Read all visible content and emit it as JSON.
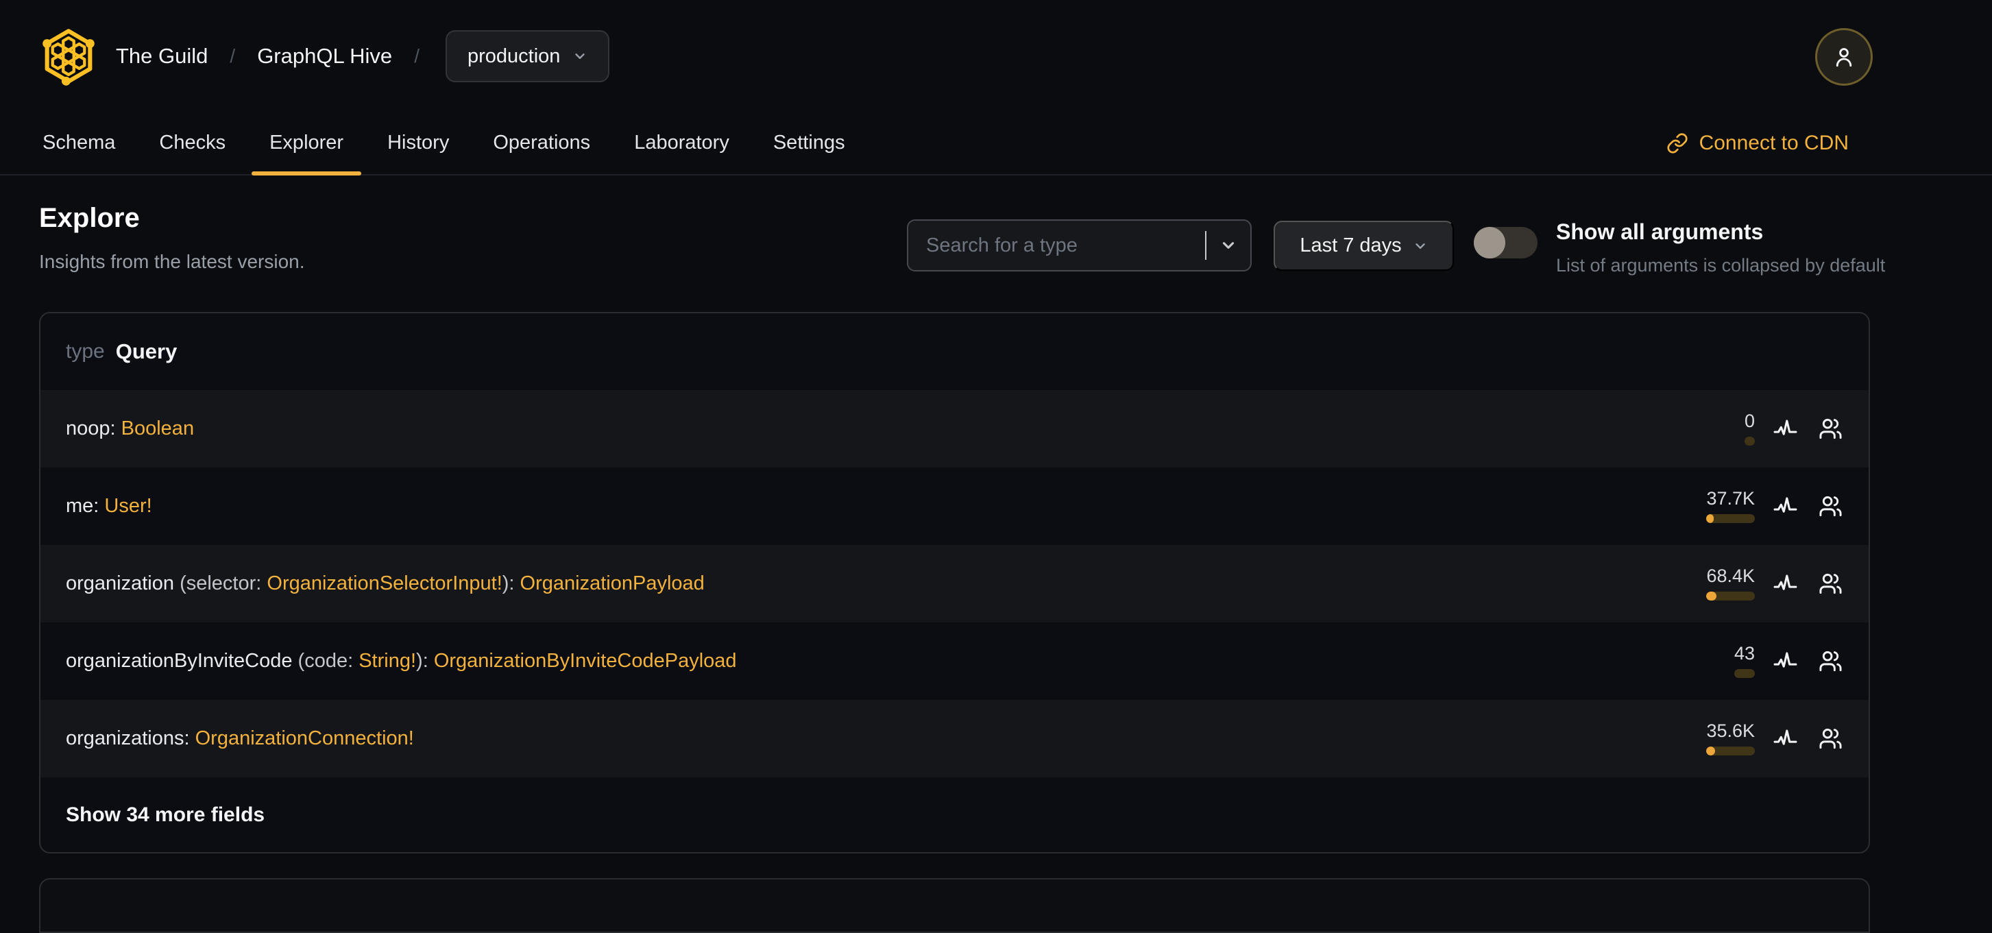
{
  "brand": {
    "org": "The Guild",
    "separator": "/",
    "project": "GraphQL Hive",
    "target": "production"
  },
  "tabs": {
    "items": [
      "Schema",
      "Checks",
      "Explorer",
      "History",
      "Operations",
      "Laboratory",
      "Settings"
    ],
    "active": "Explorer"
  },
  "cdn": {
    "label": "Connect to CDN"
  },
  "page": {
    "title": "Explore",
    "subtitle": "Insights from the latest version."
  },
  "controls": {
    "search": {
      "placeholder": "Search for a type"
    },
    "period": {
      "label": "Last 7 days"
    },
    "arguments_toggle": {
      "label": "Show all arguments",
      "hint": "List of arguments is collapsed by default",
      "state": "off"
    }
  },
  "card": {
    "kind": "type",
    "name": "Query",
    "rows": [
      {
        "segments": [
          {
            "text": "noop: ",
            "style": "field"
          },
          {
            "text": "Boolean",
            "style": "type"
          }
        ],
        "value": "0",
        "bar_percent": 0
      },
      {
        "segments": [
          {
            "text": "me: ",
            "style": "field"
          },
          {
            "text": "User!",
            "style": "type"
          }
        ],
        "value": "37.7K",
        "bar_percent": 15
      },
      {
        "segments": [
          {
            "text": "organization ",
            "style": "field"
          },
          {
            "text": "(selector: ",
            "style": "punct"
          },
          {
            "text": "OrganizationSelectorInput!",
            "style": "type"
          },
          {
            "text": "): ",
            "style": "punct"
          },
          {
            "text": "OrganizationPayload",
            "style": "type"
          }
        ],
        "value": "68.4K",
        "bar_percent": 21
      },
      {
        "segments": [
          {
            "text": "organizationByInviteCode ",
            "style": "field"
          },
          {
            "text": "(code: ",
            "style": "punct"
          },
          {
            "text": "String!",
            "style": "type"
          },
          {
            "text": "): ",
            "style": "punct"
          },
          {
            "text": "OrganizationByInviteCodePayload",
            "style": "type"
          }
        ],
        "value": "43",
        "bar_percent": 0
      },
      {
        "segments": [
          {
            "text": "organizations: ",
            "style": "field"
          },
          {
            "text": "OrganizationConnection!",
            "style": "type"
          }
        ],
        "value": "35.6K",
        "bar_percent": 18
      }
    ],
    "footer": "Show 34 more fields"
  },
  "colors": {
    "accent": "#f3b13d",
    "logo_gold": "#fcbf24",
    "bar_track": "#403617",
    "bar_fill": "#eda63a",
    "row_alt_bg": "#15161a",
    "page_bg": "#0a0c10"
  }
}
